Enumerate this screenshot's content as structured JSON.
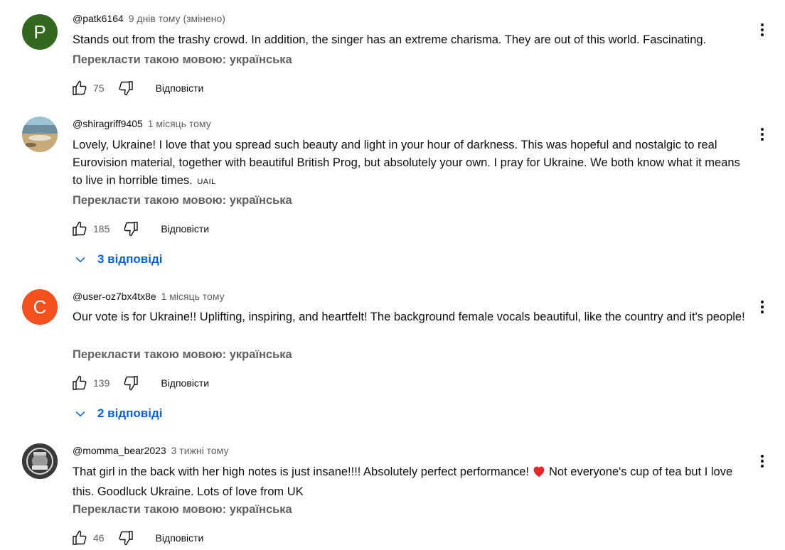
{
  "translate_label": "Перекласти такою мовою: українська",
  "reply_label": "Відповісти",
  "comments": [
    {
      "avatar_letter": "P",
      "avatar_color": "#33691e",
      "author": "@patk6164",
      "time": "9 днів тому (змінено)",
      "text": "Stands out from the trashy crowd. In addition, the singer has an extreme charisma. They are out of this world. Fascinating.",
      "likes": "75"
    },
    {
      "avatar_icon": "beach-photo",
      "author": "@shiragriff9405",
      "time": "1 місяць тому",
      "text": "Lovely, Ukraine! I love that you spread such beauty and light in your hour of darkness. This was hopeful and nostalgic to real Eurovision material, together with beautiful British Prog, but absolutely your own. I pray for Ukraine. We both know what it means to live in horrible times.",
      "text_tag": "UAIL",
      "likes": "185",
      "replies": "3 відповіді"
    },
    {
      "avatar_letter": "C",
      "avatar_color": "#f4511e",
      "author": "@user-oz7bx4tx8e",
      "time": "1 місяць тому",
      "text": "Our vote is for Ukraine!! Uplifting, inspiring, and heartfelt! The background female vocals beautiful, like the country and it's people!",
      "likes": "139",
      "replies": "2 відповіді"
    },
    {
      "avatar_icon": "badge-photo",
      "author": "@momma_bear2023",
      "time": "3 тижні тому",
      "text_before": "That girl in the back with her high notes  is just insane!!!! Absolutely perfect performance!",
      "text_after": "Not everyone's cup of tea but I love this. Goodluck Ukraine. Lots of love from UK",
      "likes": "46"
    }
  ]
}
